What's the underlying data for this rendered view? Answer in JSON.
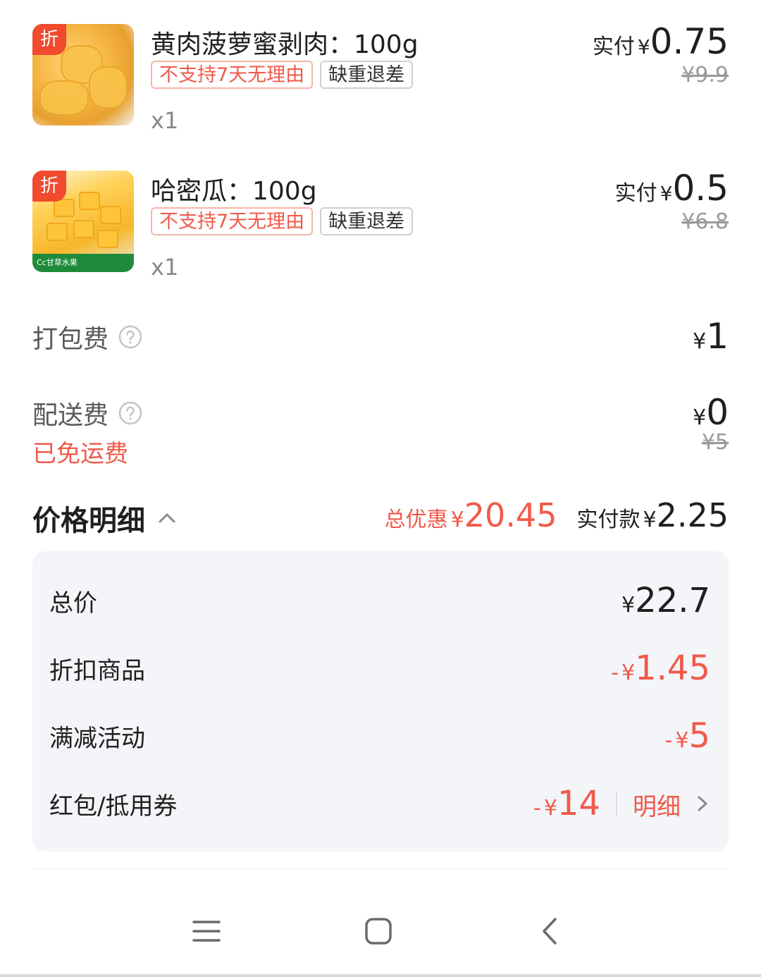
{
  "products": [
    {
      "name": "黄肉菠萝蜜剥肉：100g",
      "badge": "折",
      "tags": [
        "不支持7天无理由",
        "缺重退差"
      ],
      "qty": "x1",
      "paid_label": "实付",
      "currency": "¥",
      "paid": "0.75",
      "original": "¥9.9",
      "thumb_icon": "jackfruit-image"
    },
    {
      "name": "哈密瓜：100g",
      "badge": "折",
      "tags": [
        "不支持7天无理由",
        "缺重退差"
      ],
      "qty": "x1",
      "paid_label": "实付",
      "currency": "¥",
      "paid": "0.5",
      "original": "¥6.8",
      "thumb_icon": "hami-melon-image",
      "thumb_brand": "Cc甘草水果"
    }
  ],
  "fees": {
    "packing": {
      "label": "打包费",
      "currency": "¥",
      "value": "1"
    },
    "delivery": {
      "label": "配送费",
      "note": "已免运费",
      "currency": "¥",
      "value": "0",
      "original": "¥5"
    }
  },
  "price_detail": {
    "title": "价格明细",
    "total_discount_label": "总优惠",
    "total_discount_currency": "¥",
    "total_discount": "20.45",
    "paid_label": "实付款",
    "paid_currency": "¥",
    "paid": "2.25",
    "rows": [
      {
        "label": "总价",
        "prefix": "",
        "currency": "¥",
        "value": "22.7"
      },
      {
        "label": "折扣商品",
        "prefix": "-",
        "currency": "¥",
        "value": "1.45"
      },
      {
        "label": "满减活动",
        "prefix": "-",
        "currency": "¥",
        "value": "5"
      },
      {
        "label": "红包/抵用券",
        "prefix": "-",
        "currency": "¥",
        "value": "14",
        "link": "明细"
      }
    ]
  },
  "colors": {
    "accent_red": "#f05a4a",
    "badge_red": "#f04a2f",
    "panel_bg": "#f3f5f8",
    "muted_text": "#9a9a9a"
  },
  "navbar_icons": [
    "menu-icon",
    "home-icon",
    "back-icon"
  ]
}
